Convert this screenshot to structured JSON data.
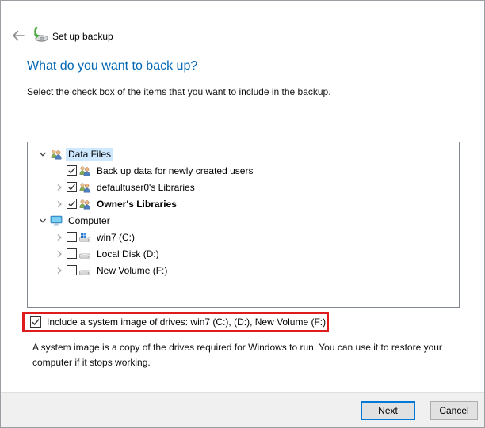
{
  "header": {
    "title": "Set up backup",
    "back_icon": "back-arrow-icon",
    "app_icon": "backup-disc-green-arrow-icon"
  },
  "page": {
    "heading": "What do you want to back up?",
    "instruction": "Select the check box of the items that you want to include in the backup."
  },
  "tree": {
    "items": [
      {
        "label": "Data Files",
        "level": 1,
        "expander": "expanded",
        "checkbox": null,
        "icon": "users",
        "selected": true,
        "bold": false
      },
      {
        "label": "Back up data for newly created users",
        "level": 2,
        "expander": "none",
        "checkbox": "checked",
        "icon": "users",
        "selected": false,
        "bold": false
      },
      {
        "label": "defaultuser0's Libraries",
        "level": 2,
        "expander": "collapsed",
        "checkbox": "checked",
        "icon": "users",
        "selected": false,
        "bold": false
      },
      {
        "label": "Owner's Libraries",
        "level": 2,
        "expander": "collapsed",
        "checkbox": "checked",
        "icon": "users",
        "selected": false,
        "bold": true
      },
      {
        "label": "Computer",
        "level": 1,
        "expander": "expanded",
        "checkbox": null,
        "icon": "computer",
        "selected": false,
        "bold": false
      },
      {
        "label": "win7 (C:)",
        "level": 2,
        "expander": "collapsed",
        "checkbox": "unchecked",
        "icon": "drive-windows",
        "selected": false,
        "bold": false
      },
      {
        "label": "Local Disk (D:)",
        "level": 2,
        "expander": "collapsed",
        "checkbox": "unchecked",
        "icon": "drive",
        "selected": false,
        "bold": false
      },
      {
        "label": "New Volume (F:)",
        "level": 2,
        "expander": "collapsed",
        "checkbox": "unchecked",
        "icon": "drive",
        "selected": false,
        "bold": false
      }
    ]
  },
  "system_image": {
    "label": "Include a system image of drives: win7 (C:), (D:), New Volume (F:)",
    "checked": true,
    "description": "A system image is a copy of the drives required for Windows to run. You can use it to restore your computer if it stops working."
  },
  "footer": {
    "next_label": "Next",
    "cancel_label": "Cancel"
  },
  "colors": {
    "heading_blue": "#0066b4",
    "accent_blue": "#0078d7",
    "selection_highlight": "#cde8ff",
    "annotation_red": "#e01b1b",
    "footer_gray": "#f0f0f0",
    "button_gray": "#e1e1e1",
    "tree_border": "#82888f"
  }
}
